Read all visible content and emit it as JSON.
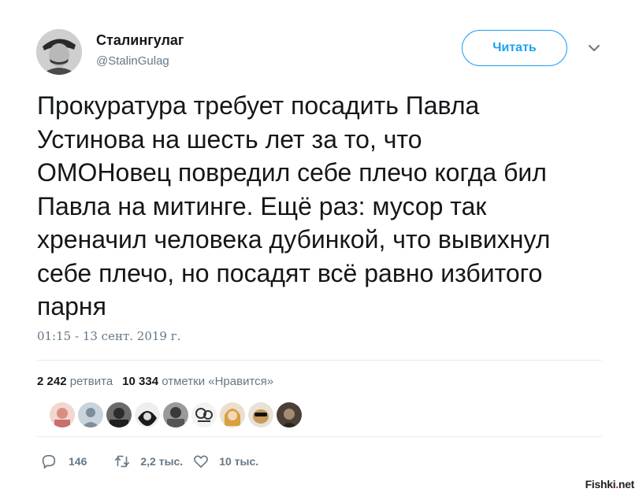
{
  "author": {
    "display_name": "Сталингулаг",
    "handle": "@StalinGulag",
    "avatar_icon": "portrait-avatar"
  },
  "follow_button": {
    "label": "Читать",
    "color": "#1da1f2"
  },
  "menu_icon": "chevron-down-icon",
  "tweet": {
    "text": "Прокуратура требует посадить Павла\nУстинова на шесть лет за то, что\nОМОНовец повредил себе плечо когда бил\nПавла на митинге. Ещё раз: мусор так\nхреначил человека дубинкой, что вывихнул\nсебе плечо, но посадят всё равно избитого\nпарня",
    "timestamp": "01:15 - 13 сент. 2019 г."
  },
  "stats": {
    "retweets_count": "2 242",
    "retweets_label": "ретвита",
    "likes_count": "10 334",
    "likes_label": "отметки «Нравится»"
  },
  "likers": [
    "liker-1",
    "liker-2",
    "liker-3",
    "liker-4",
    "liker-5",
    "liker-6",
    "liker-7",
    "liker-8",
    "liker-9"
  ],
  "actions": {
    "reply_count": "146",
    "retweet_count": "2,2 тыс.",
    "like_count": "10 тыс."
  },
  "watermark": {
    "brand": "Fishki",
    "dot": ".",
    "tld": "net"
  }
}
